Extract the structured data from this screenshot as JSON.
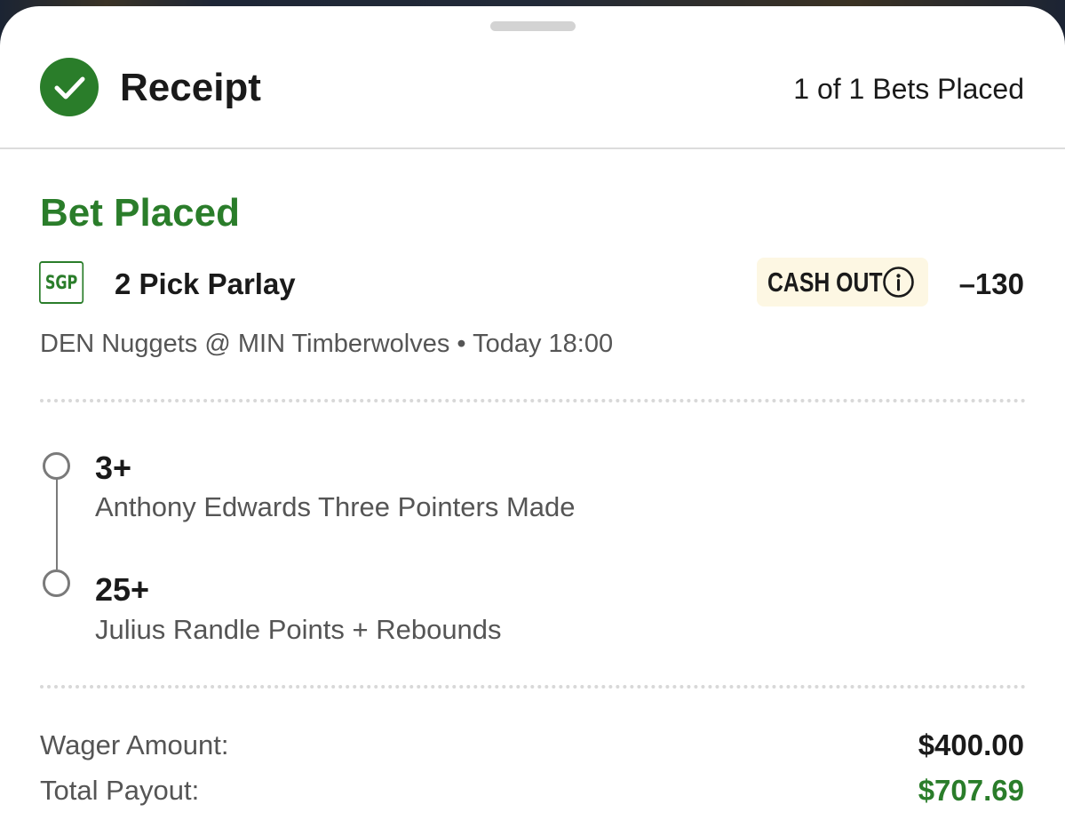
{
  "header": {
    "title": "Receipt",
    "bets_placed": "1 of 1 Bets Placed"
  },
  "bet": {
    "status": "Bet Placed",
    "badge": "SGP",
    "type": "2 Pick Parlay",
    "cashout_label": "CASH OUT",
    "odds": "–130",
    "matchup": "DEN Nuggets @ MIN Timberwolves • Today 18:00",
    "legs": [
      {
        "line": "3+",
        "description": "Anthony Edwards Three Pointers Made"
      },
      {
        "line": "25+",
        "description": "Julius Randle Points + Rebounds"
      }
    ]
  },
  "summary": {
    "wager_label": "Wager Amount:",
    "wager_value": "$400.00",
    "payout_label": "Total Payout:",
    "payout_value": "$707.69"
  },
  "icons": {
    "status": "checkmark-icon",
    "cashout_info": "info-icon"
  },
  "colors": {
    "accent_green": "#2a7d2a",
    "cashout_bg": "#fdf7e3",
    "text_primary": "#1a1a1a",
    "text_secondary": "#555555"
  }
}
